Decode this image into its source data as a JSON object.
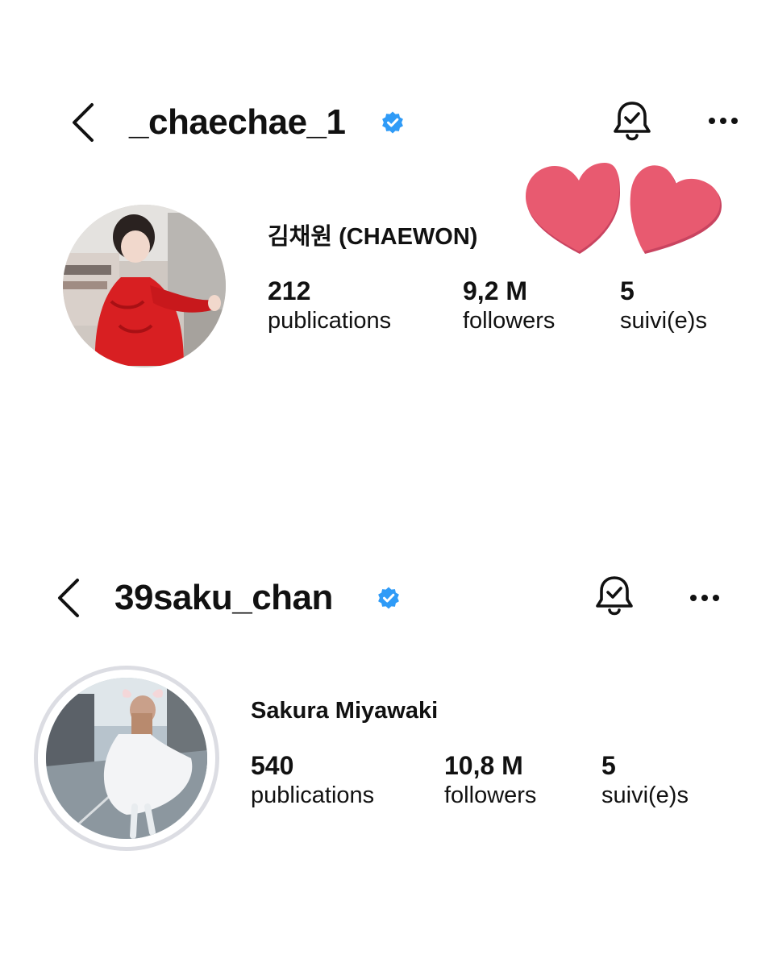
{
  "profiles": [
    {
      "username": "_chaechae_1",
      "display_name": "김채원 (CHAEWON)",
      "verified": true,
      "stats": [
        {
          "count": "212",
          "label": "publications"
        },
        {
          "count": "9,2 M",
          "label": "followers"
        },
        {
          "count": "5",
          "label": "suivi(e)s"
        }
      ],
      "icons": {
        "back": "chevron-left-icon",
        "bell": "bell-check-icon",
        "more": "more-horizontal-icon"
      }
    },
    {
      "username": "39saku_chan",
      "display_name": "Sakura Miyawaki",
      "verified": true,
      "stats": [
        {
          "count": "540",
          "label": "publications"
        },
        {
          "count": "10,8 M",
          "label": "followers"
        },
        {
          "count": "5",
          "label": "suivi(e)s"
        }
      ],
      "icons": {
        "back": "chevron-left-icon",
        "bell": "bell-check-icon",
        "more": "more-horizontal-icon"
      }
    }
  ],
  "decorations": {
    "hearts": "two-hearts-sticker"
  },
  "colors": {
    "verified_badge": "#2f9bf7",
    "heart": "#e85a70",
    "text": "#111111",
    "ring": "#dcdde3"
  }
}
